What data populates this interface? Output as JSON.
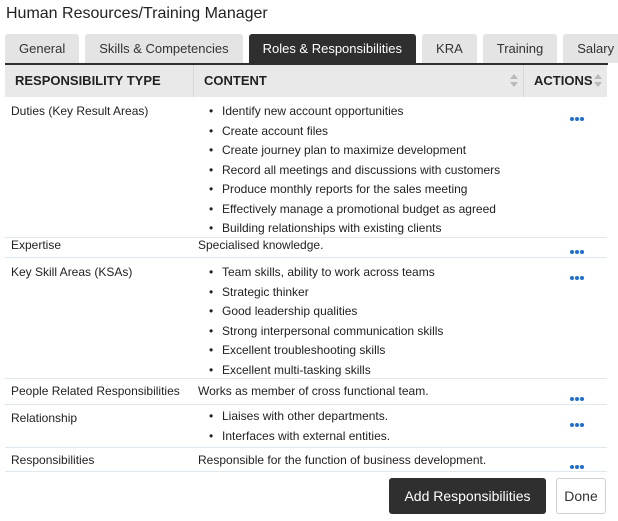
{
  "page": {
    "title": "Human Resources/Training Manager"
  },
  "tabs": [
    {
      "label": "General"
    },
    {
      "label": "Skills & Competencies"
    },
    {
      "label": "Roles & Responsibilities",
      "active": true
    },
    {
      "label": "KRA"
    },
    {
      "label": "Training"
    },
    {
      "label": "Salary"
    }
  ],
  "table": {
    "headers": [
      "RESPONSIBILITY TYPE",
      "CONTENT",
      "ACTIONS"
    ],
    "rows": [
      {
        "type": "Duties (Key Result Areas)",
        "items": [
          "Identify new account opportunities",
          "Create account files",
          "Create journey plan to maximize development",
          "Record all meetings and discussions with customers",
          "Produce monthly reports for the sales meeting",
          "Effectively manage a promotional budget as agreed",
          "Building relationships with existing clients"
        ]
      },
      {
        "type": "Expertise",
        "text": "Specialised knowledge."
      },
      {
        "type": "Key Skill Areas (KSAs)",
        "items": [
          "Team skills, ability to work across teams",
          "Strategic thinker",
          "Good leadership qualities",
          "Strong interpersonal communication skills",
          "Excellent troubleshooting skills",
          "Excellent multi-tasking skills"
        ]
      },
      {
        "type": "People Related Responsibilities",
        "text": "Works as member of cross functional team."
      },
      {
        "type": "Relationship",
        "items": [
          "Liaises with other departments.",
          "Interfaces with external entities."
        ]
      },
      {
        "type": "Responsibilities",
        "text": "Responsible for the function of business development."
      }
    ]
  },
  "buttons": {
    "add": "Add Responsibilities",
    "done": "Done"
  },
  "colors": {
    "accent": "#1f6fd1",
    "dark": "#2f2f2f"
  }
}
